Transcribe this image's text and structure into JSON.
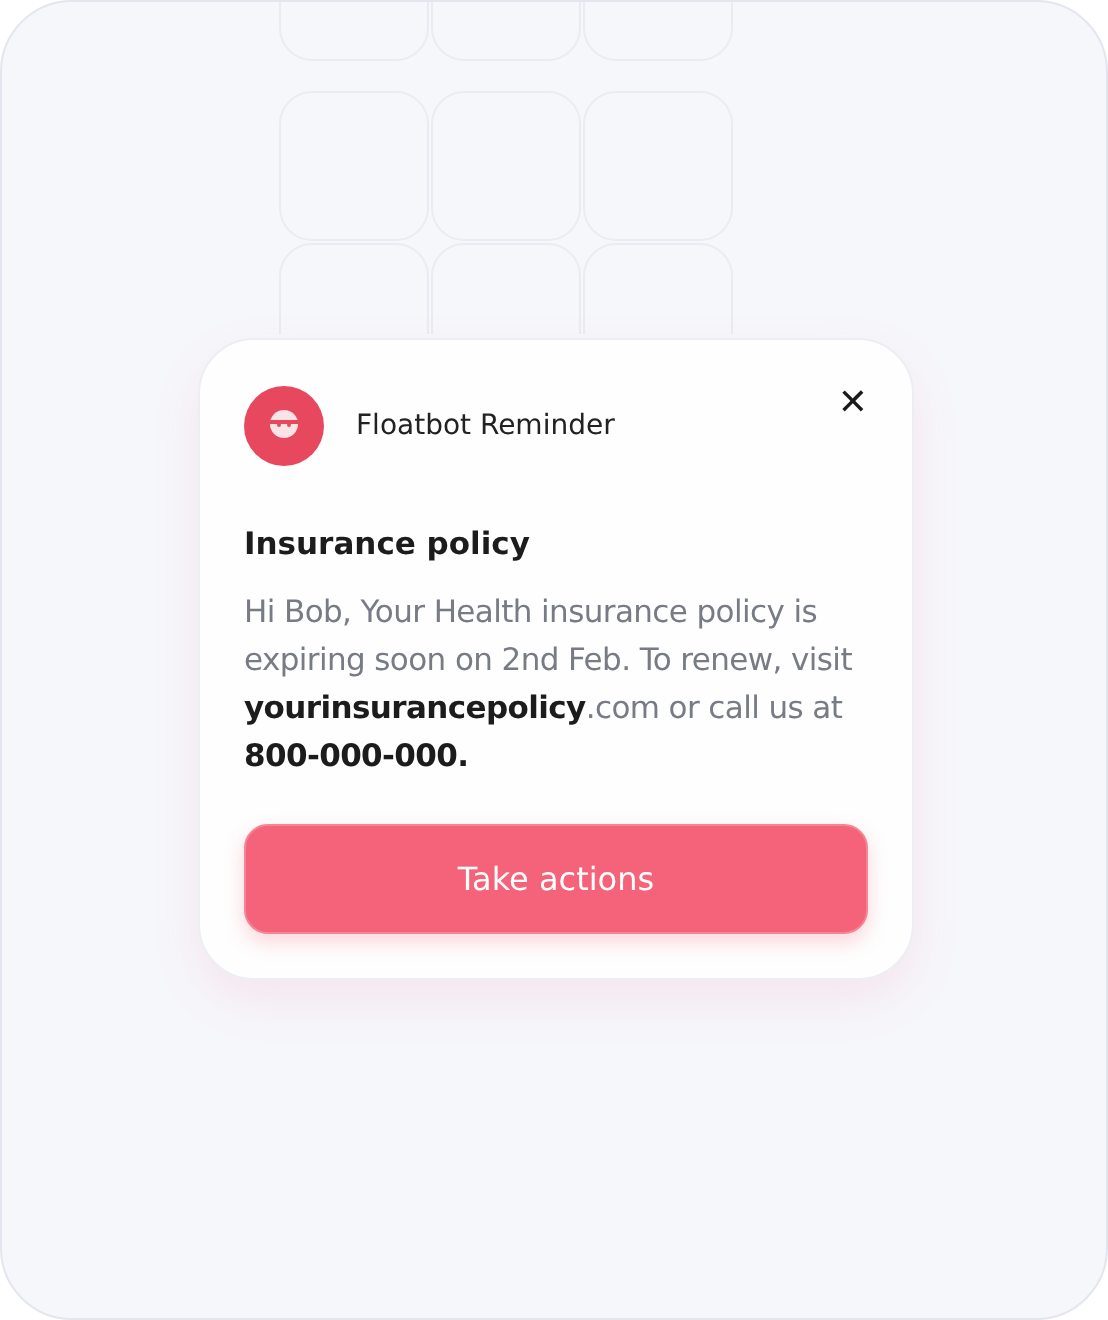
{
  "notification": {
    "sender": "Floatbot Reminder",
    "close_icon": "✕",
    "title": "Insurance policy",
    "message": "Hi Bob, Your Health insurance policy is expiring soon on 2nd Feb. To renew, visit **yourinsurancepolicy**.com or call us at **800-000-000.**",
    "action_button": "Take actions"
  }
}
